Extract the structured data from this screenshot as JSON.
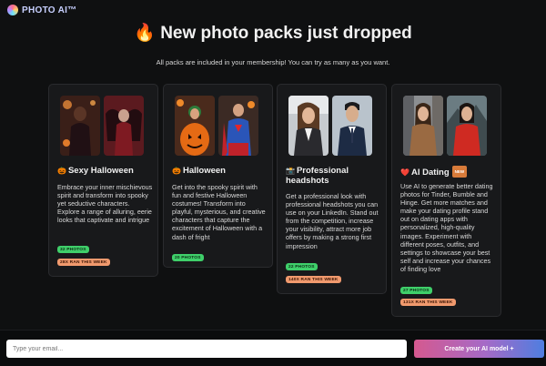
{
  "brand": {
    "name": "PHOTO AI™",
    "logo_icon": "multicolor-ring-icon"
  },
  "hero": {
    "headline_emoji": "🔥",
    "headline": "New photo packs just dropped",
    "subtitle": "All packs are included in your membership! You can try as many as you want."
  },
  "packs": [
    {
      "emoji": "🎃",
      "title": "Sexy Halloween",
      "description": "Embrace your inner mischievous spirit and transform into spooky yet seductive characters. Explore a range of alluring, eerie looks that captivate and intrigue",
      "photos": "32 PHOTOS",
      "ran": "28X RAN THIS WEEK",
      "badge": ""
    },
    {
      "emoji": "🎃",
      "title": "Halloween",
      "description": "Get into the spooky spirit with fun and festive Halloween costumes! Transform into playful, mysterious, and creative characters that capture the excitement of Halloween with a dash of fright",
      "photos": "20 PHOTOS",
      "ran": "",
      "badge": ""
    },
    {
      "emoji": "📸",
      "title": "Professional headshots",
      "description": "Get a professional look with professional headshots you can use on your LinkedIn. Stand out from the competition, increase your visibility, attract more job offers by making a strong first impression",
      "photos": "22 PHOTOS",
      "ran": "140X RAN THIS WEEK",
      "badge": ""
    },
    {
      "emoji": "❤️",
      "title": "AI Dating",
      "description": "Use AI to generate better dating photos for Tinder, Bumble and Hinge. Get more matches and make your dating profile stand out on dating apps with personalized, high-quality images. Experiment with different poses, outfits, and settings to showcase your best self and increase your chances of finding love",
      "photos": "27 PHOTOS",
      "ran": "131X RAN THIS WEEK",
      "badge": "NEW"
    }
  ],
  "signup": {
    "email_placeholder": "Type your email...",
    "cta_label": "Create your AI model +"
  },
  "colors": {
    "background": "#0f1011",
    "card": "#18191b",
    "photos_pill": "#3fcf6a",
    "ran_pill": "#f19a6e",
    "cta_gradient_start": "#d5598f",
    "cta_gradient_end": "#4e7ee0"
  }
}
